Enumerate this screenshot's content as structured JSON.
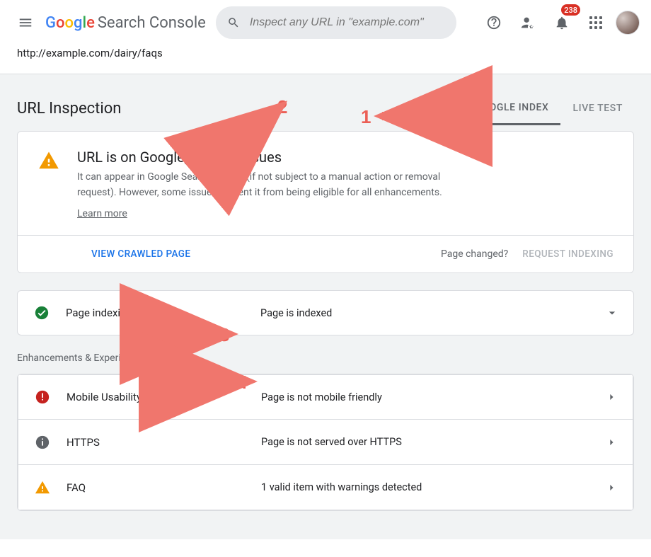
{
  "app_name_google": "Google",
  "app_name_suffix": "Search Console",
  "search": {
    "placeholder": "Inspect any URL in \"example.com\""
  },
  "notifications_count": "238",
  "inspected_url": "http://example.com/dairy/faqs",
  "page_title": "URL Inspection",
  "tabs": {
    "google_index": "GOOGLE INDEX",
    "live_test": "LIVE TEST"
  },
  "status": {
    "heading": "URL is on Google, but has issues",
    "desc": "It can appear in Google Search results (if not subject to a manual action or removal request). However, some issues prevent it from being eligible for all enhancements.",
    "learn_more": "Learn more",
    "view_crawled": "VIEW CRAWLED PAGE",
    "page_changed": "Page changed?",
    "request_indexing": "REQUEST INDEXING"
  },
  "indexing": {
    "label": "Page indexing",
    "value": "Page is indexed"
  },
  "section_enhancements": "Enhancements & Experience",
  "rows": [
    {
      "icon": "error",
      "label": "Mobile Usability",
      "value": "Page is not mobile friendly"
    },
    {
      "icon": "info",
      "label": "HTTPS",
      "value": "Page is not served over HTTPS"
    },
    {
      "icon": "warn",
      "label": "FAQ",
      "value": "1 valid item with warnings detected"
    }
  ],
  "annotations": {
    "a1": "1",
    "a2": "2",
    "a3": "3",
    "a4": "4"
  }
}
